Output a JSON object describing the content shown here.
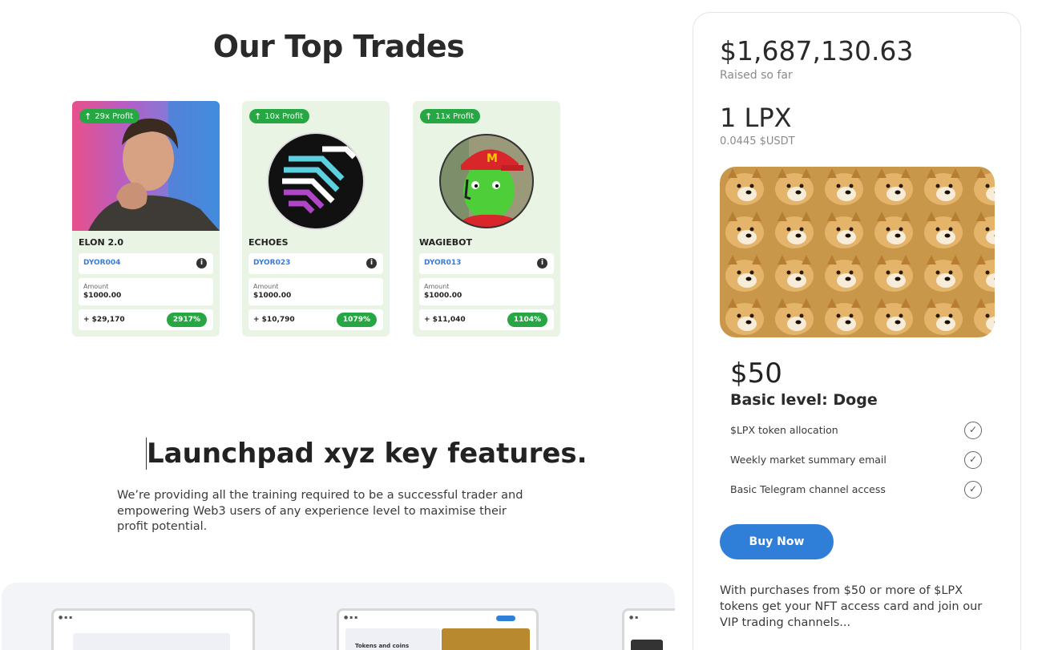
{
  "top_trades": {
    "title": "Our Top Trades",
    "cards": [
      {
        "name": "ELON 2.0",
        "profit": "29x Profit",
        "code": "DYOR004",
        "amount_label": "Amount",
        "amount": "$1000.00",
        "gain": "+ $29,170",
        "percent": "2917%"
      },
      {
        "name": "ECHOES",
        "profit": "10x Profit",
        "code": "DYOR023",
        "amount_label": "Amount",
        "amount": "$1000.00",
        "gain": "+ $10,790",
        "percent": "1079%"
      },
      {
        "name": "WAGIEBOT",
        "profit": "11x Profit",
        "code": "DYOR013",
        "amount_label": "Amount",
        "amount": "$1000.00",
        "gain": "+ $11,040",
        "percent": "1104%"
      }
    ]
  },
  "features": {
    "title": "Launchpad xyz key features.",
    "description": "We’re providing all the training required to be a successful trader and empowering Web3 users of any experience level to maximise their profit potential."
  },
  "preview": {
    "screen2_label": "Tokens and coins"
  },
  "presale": {
    "raised_amount": "$1,687,130.63",
    "raised_label": "Raised so far",
    "token": "1 LPX",
    "token_price": "0.0445 $USDT",
    "tier_price": "$50",
    "tier_name": "Basic level: Doge",
    "benefits": [
      "$LPX token allocation",
      "Weekly market summary email",
      "Basic Telegram channel access"
    ],
    "buy_label": "Buy Now",
    "note": "With purchases from $50 or more of $LPX tokens get your NFT access card and join our VIP trading channels..."
  },
  "colors": {
    "green": "#27a744",
    "card_bg": "#eaf4e4",
    "accent_blue": "#2f7ed8"
  }
}
